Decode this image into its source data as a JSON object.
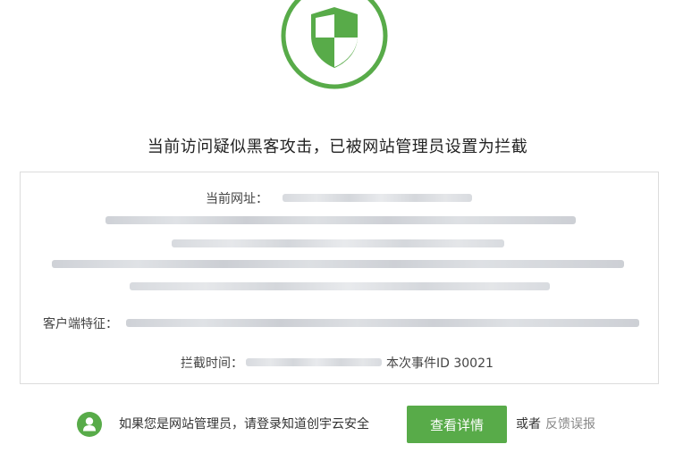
{
  "colors": {
    "brand_green": "#58ab49",
    "border_gray": "#dcdcdc",
    "text_dark": "#333333",
    "link_gray": "#888888"
  },
  "icons": {
    "hero": "shield-icon",
    "admin": "user-icon"
  },
  "headline": "当前访问疑似黑客攻击，已被网站管理员设置为拦截",
  "info": {
    "url_label": "当前网址：",
    "client_label": "客户端特征：",
    "time_label": "拦截时间：",
    "event_id": "本次事件ID 30021"
  },
  "footer": {
    "admin_text": "如果您是网站管理员，请登录知道创宇云安全",
    "detail_button": "查看详情",
    "or_text": "或者",
    "feedback_link": "反馈误报"
  }
}
